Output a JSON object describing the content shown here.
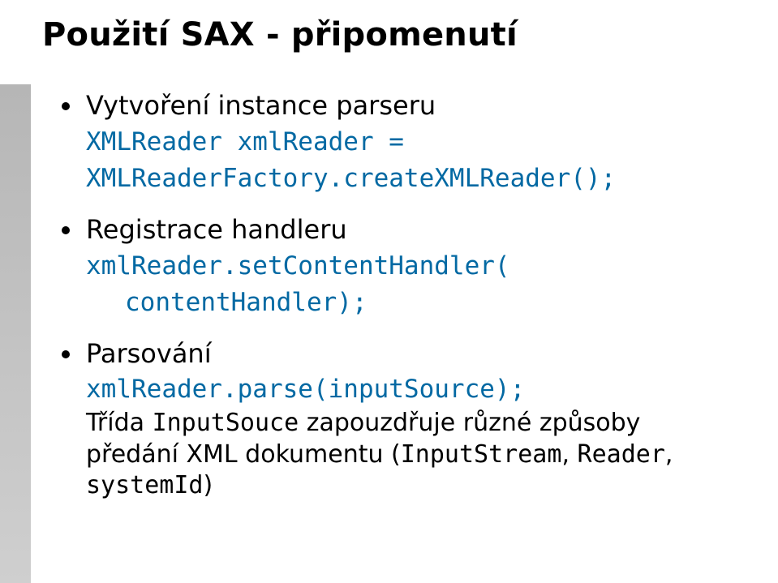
{
  "title": "Použití SAX - připomenutí",
  "bullets": [
    {
      "heading": "Vytvoření instance parseru",
      "code_lines": [
        "XMLReader xmlReader =",
        "XMLReaderFactory.createXMLReader();"
      ]
    },
    {
      "heading": "Registrace handleru",
      "code_lines": [
        "xmlReader.setContentHandler(",
        "  contentHandler);"
      ]
    },
    {
      "heading": "Parsování",
      "code_lines": [
        "xmlReader.parse(inputSource);"
      ],
      "tail_pre": "Třída ",
      "tail_code1": "InputSouce",
      "tail_mid": " zapouzdřuje různé způsoby předání XML dokumentu (",
      "tail_code2": "InputStream",
      "tail_sep": ", ",
      "tail_code3": "Reader",
      "tail_sep2": ", ",
      "tail_code4": "systemId",
      "tail_post": ")"
    }
  ]
}
